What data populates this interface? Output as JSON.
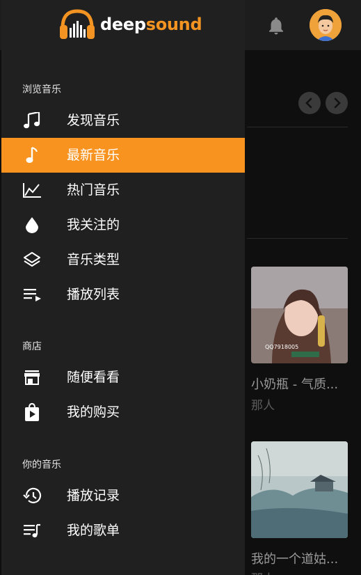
{
  "app": {
    "logo_part1": "deep",
    "logo_part2": "sound",
    "accent": "#f7931e"
  },
  "sidebar": {
    "sections": [
      {
        "title": "浏览音乐",
        "items": [
          {
            "label": "发现音乐",
            "icon": "music-note-icon"
          },
          {
            "label": "最新音乐",
            "icon": "single-note-icon",
            "active": true
          },
          {
            "label": "热门音乐",
            "icon": "chart-line-icon"
          },
          {
            "label": "我关注的",
            "icon": "drop-icon"
          },
          {
            "label": "音乐类型",
            "icon": "layers-icon"
          },
          {
            "label": "播放列表",
            "icon": "playlist-icon"
          }
        ]
      },
      {
        "title": "商店",
        "items": [
          {
            "label": "随便看看",
            "icon": "store-icon"
          },
          {
            "label": "我的购买",
            "icon": "shopping-bag-icon"
          }
        ]
      },
      {
        "title": "你的音乐",
        "items": [
          {
            "label": "播放记录",
            "icon": "history-icon"
          },
          {
            "label": "我的歌单",
            "icon": "queue-music-icon"
          }
        ]
      }
    ]
  },
  "main": {
    "cards": [
      {
        "title": "小奶瓶 - 气质...",
        "artist": "那人",
        "image_text": "QQ7918005"
      },
      {
        "title": "我的一个道姑...",
        "artist": "那人"
      }
    ]
  }
}
